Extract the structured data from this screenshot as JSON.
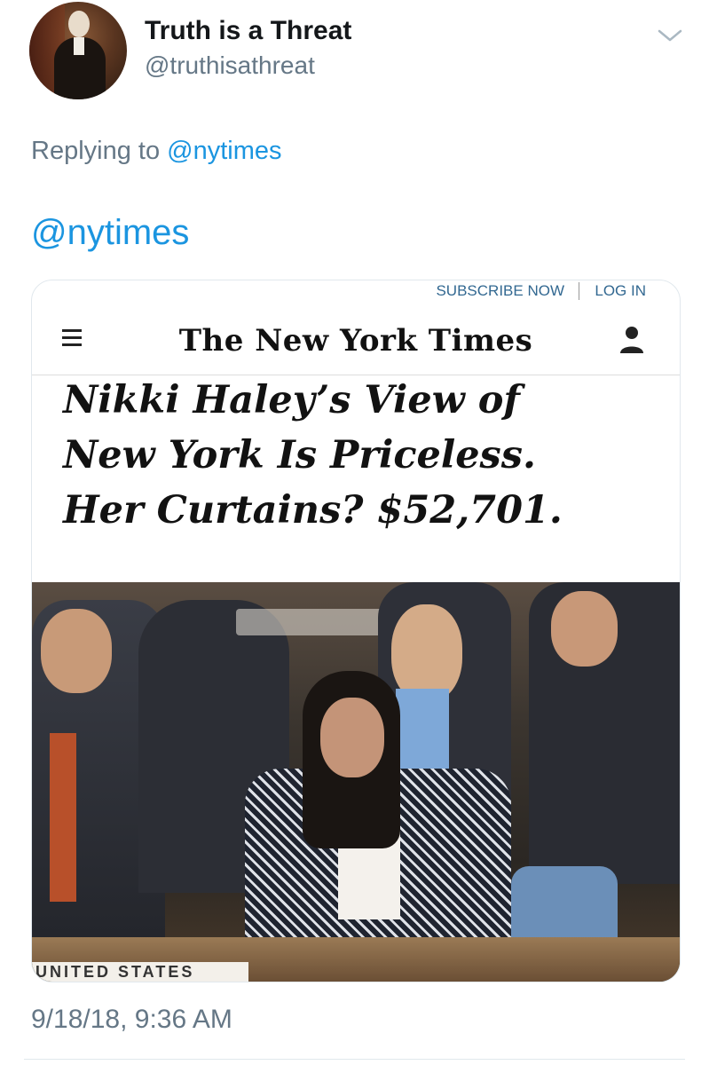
{
  "user": {
    "display_name": "Truth is a Threat",
    "handle": "@truthisathreat"
  },
  "reply": {
    "prefix": "Replying to ",
    "mention": "@nytimes"
  },
  "tweet": {
    "text": "@nytimes",
    "timestamp": "9/18/18, 9:36 AM"
  },
  "media": {
    "subscribe_label": "SUBSCRIBE NOW",
    "login_label": "LOG IN",
    "logo_text": "The New York Times",
    "headline_lines": [
      "Nikki Haley’s View of",
      "New York Is Priceless.",
      "Her Curtains? $52,701."
    ],
    "nameplate_text": "UNITED STATES"
  },
  "colors": {
    "link": "#1b95e0",
    "secondary": "#657786",
    "nyt_link": "#326891"
  },
  "icons": [
    "caret-down-icon",
    "hamburger-menu-icon",
    "user-account-icon"
  ]
}
